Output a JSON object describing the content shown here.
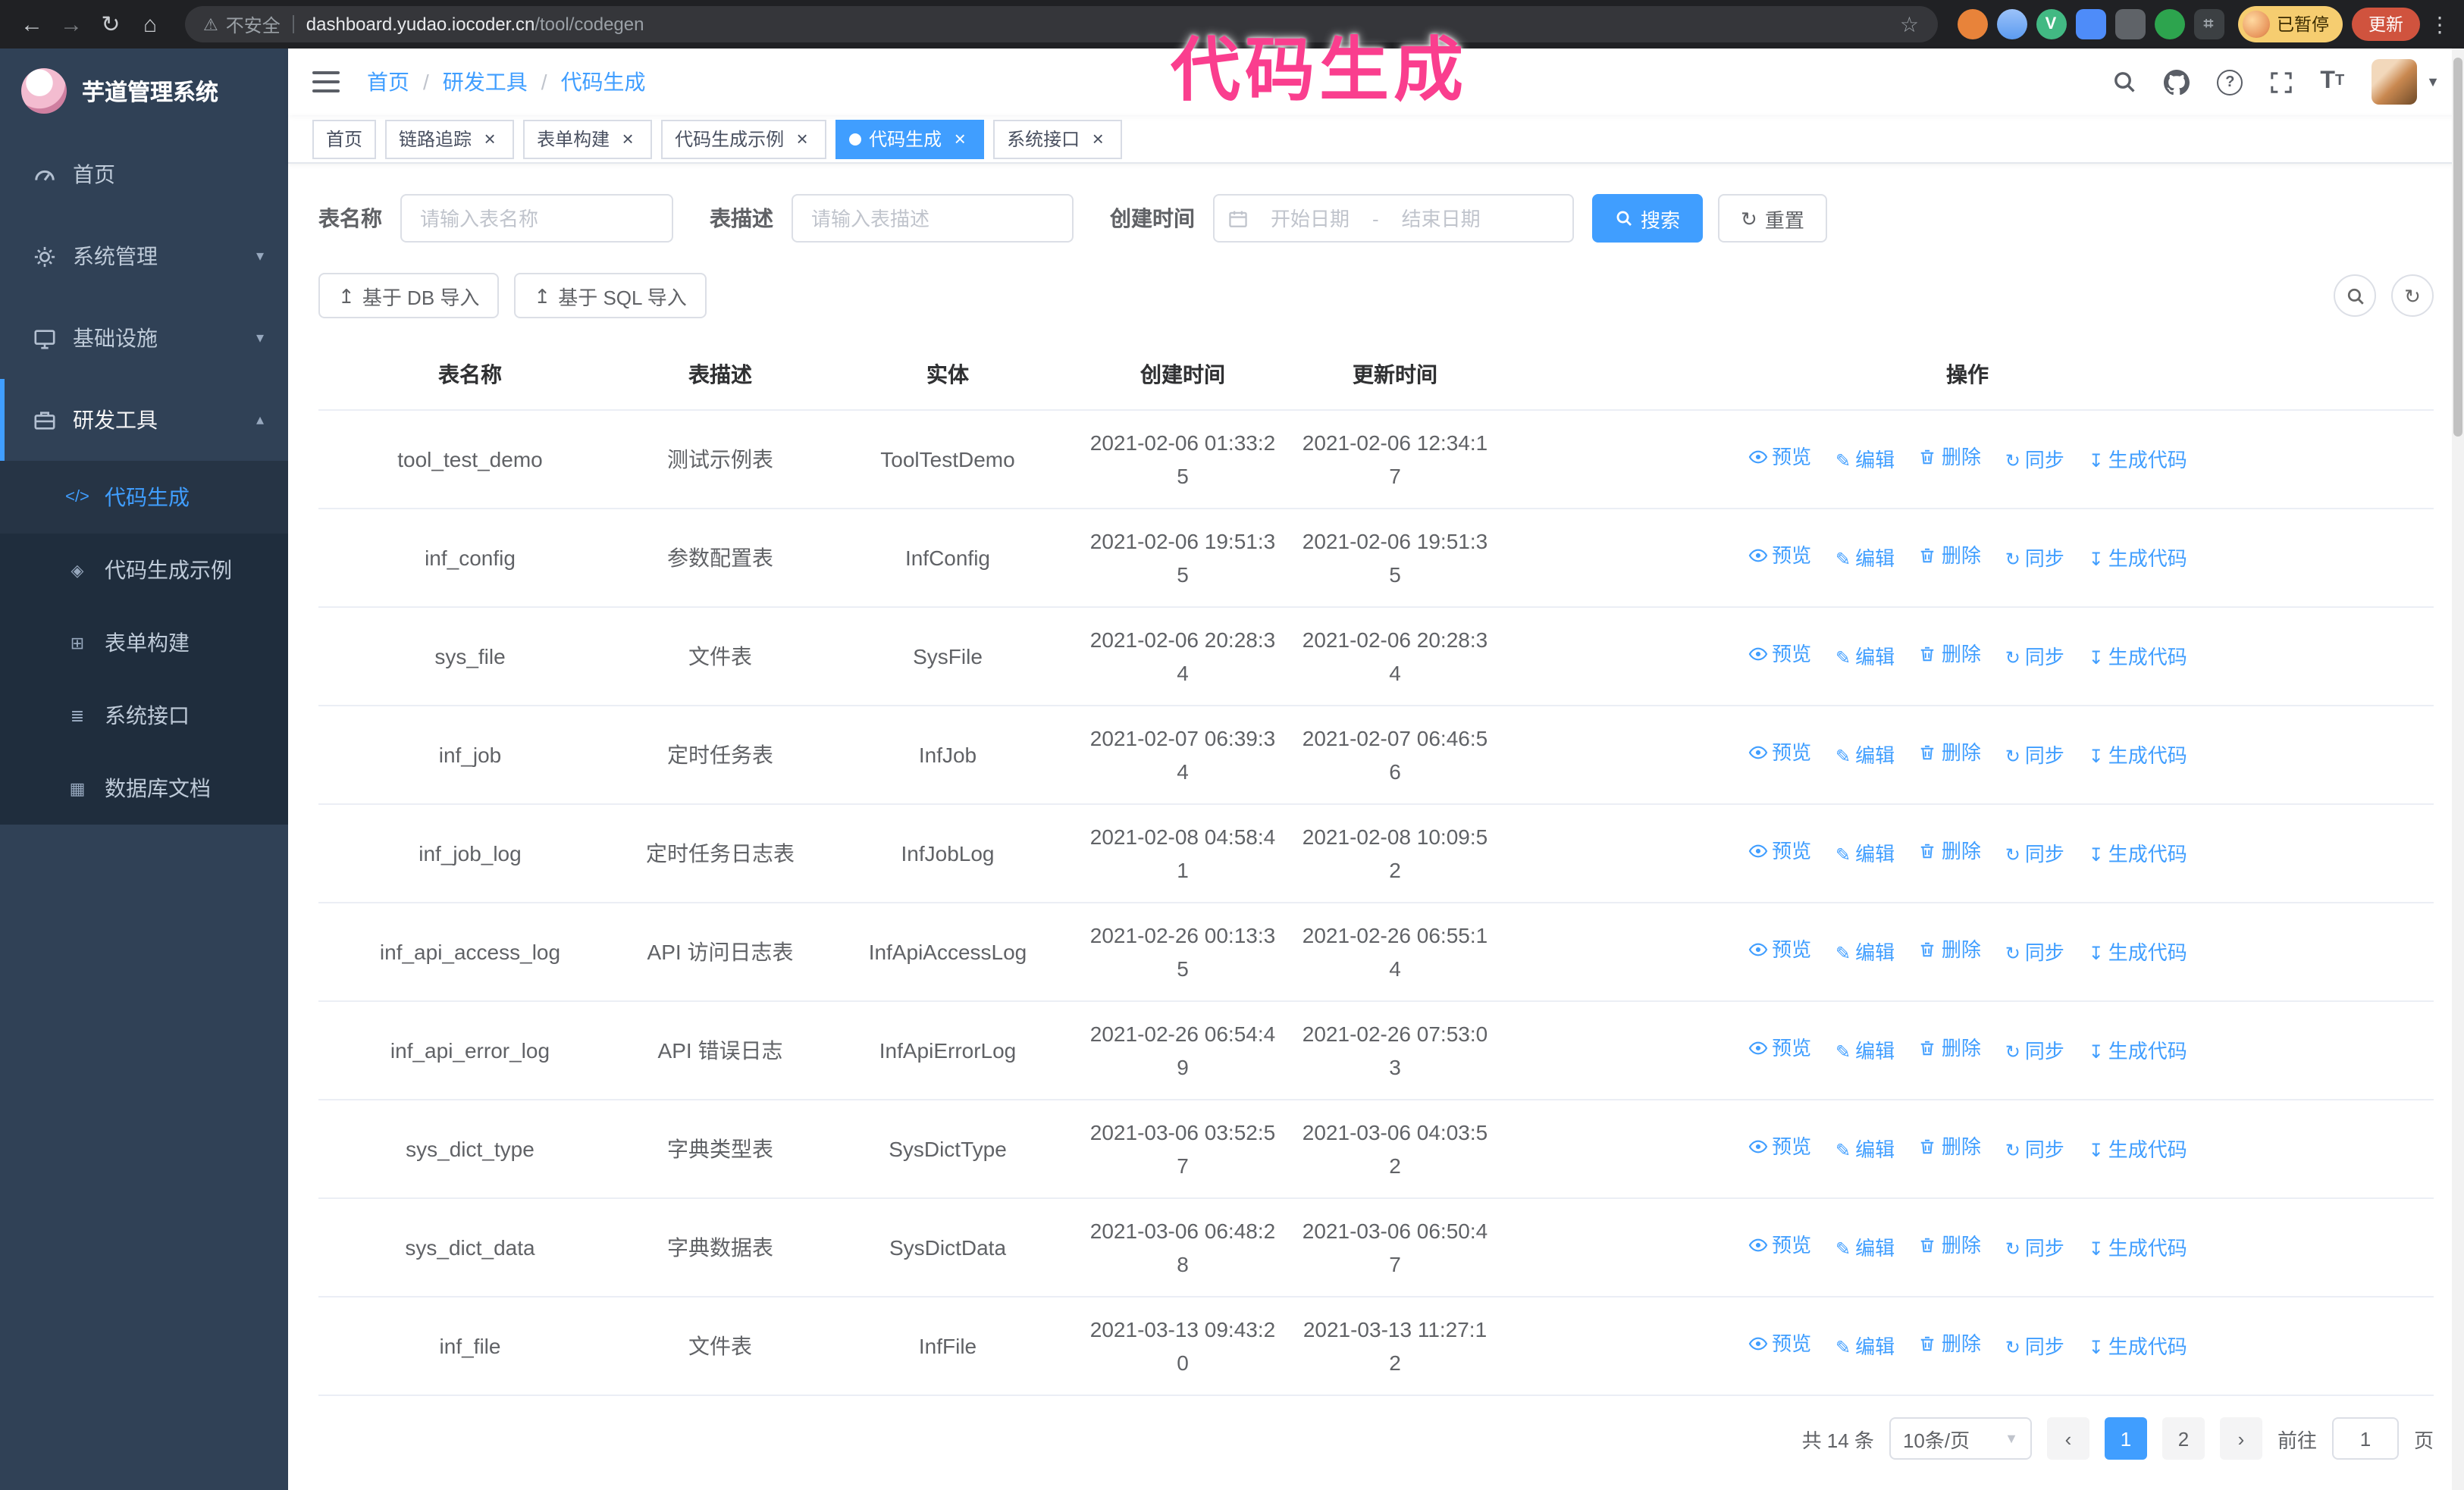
{
  "annotation": {
    "text": "代码生成"
  },
  "browser": {
    "security_label": "不安全",
    "url_domain": "dashboard.yudao.iocoder.cn",
    "url_path": "/tool/codegen",
    "profile_label": "已暂停",
    "update_label": "更新"
  },
  "icons": {
    "back": "←",
    "forward": "→",
    "reload": "↻",
    "home": "⌂",
    "warning": "⚠",
    "star": "☆",
    "kebab": "⋮",
    "chevron_down": "▾",
    "chevron_up": "▴",
    "caret_down": "▼",
    "ext_v": "V",
    "ext_puzzle": "⌗",
    "question": "?",
    "fontsize_large": "T",
    "fontsize_small": "T",
    "refresh": "↻",
    "upload": "↥",
    "edit": "✎",
    "sync": "↻",
    "download": "↧",
    "code": "</>",
    "shield": "◈",
    "form": "⊞",
    "api": "≣",
    "db": "▦",
    "prev": "‹",
    "next": "›",
    "crumb_sep": "/",
    "url_sep": "|",
    "range_sep": "-"
  },
  "sidebar": {
    "app_title": "芋道管理系统",
    "menu": [
      {
        "label": "首页"
      },
      {
        "label": "系统管理"
      },
      {
        "label": "基础设施"
      },
      {
        "label": "研发工具"
      }
    ],
    "submenu": [
      {
        "label": "代码生成"
      },
      {
        "label": "代码生成示例"
      },
      {
        "label": "表单构建"
      },
      {
        "label": "系统接口"
      },
      {
        "label": "数据库文档"
      }
    ]
  },
  "breadcrumb": [
    "首页",
    "研发工具",
    "代码生成"
  ],
  "tags": [
    {
      "label": "首页"
    },
    {
      "label": "链路追踪"
    },
    {
      "label": "表单构建"
    },
    {
      "label": "代码生成示例"
    },
    {
      "label": "代码生成"
    },
    {
      "label": "系统接口"
    }
  ],
  "filters": {
    "name_label": "表名称",
    "name_placeholder": "请输入表名称",
    "desc_label": "表描述",
    "desc_placeholder": "请输入表描述",
    "time_label": "创建时间",
    "start_placeholder": "开始日期",
    "end_placeholder": "结束日期",
    "search_label": "搜索",
    "reset_label": "重置"
  },
  "toolbar": {
    "import_db_label": "基于 DB 导入",
    "import_sql_label": "基于 SQL 导入"
  },
  "table": {
    "columns": [
      "表名称",
      "表描述",
      "实体",
      "创建时间",
      "更新时间",
      "操作"
    ],
    "action_labels": [
      "预览",
      "编辑",
      "删除",
      "同步",
      "生成代码"
    ],
    "rows": [
      {
        "name": "tool_test_demo",
        "desc": "测试示例表",
        "entity": "ToolTestDemo",
        "created": "2021-02-06 01:33:25",
        "updated": "2021-02-06 12:34:17"
      },
      {
        "name": "inf_config",
        "desc": "参数配置表",
        "entity": "InfConfig",
        "created": "2021-02-06 19:51:35",
        "updated": "2021-02-06 19:51:35"
      },
      {
        "name": "sys_file",
        "desc": "文件表",
        "entity": "SysFile",
        "created": "2021-02-06 20:28:34",
        "updated": "2021-02-06 20:28:34"
      },
      {
        "name": "inf_job",
        "desc": "定时任务表",
        "entity": "InfJob",
        "created": "2021-02-07 06:39:34",
        "updated": "2021-02-07 06:46:56"
      },
      {
        "name": "inf_job_log",
        "desc": "定时任务日志表",
        "entity": "InfJobLog",
        "created": "2021-02-08 04:58:41",
        "updated": "2021-02-08 10:09:52"
      },
      {
        "name": "inf_api_access_log",
        "desc": "API 访问日志表",
        "entity": "InfApiAccessLog",
        "created": "2021-02-26 00:13:35",
        "updated": "2021-02-26 06:55:14"
      },
      {
        "name": "inf_api_error_log",
        "desc": "API 错误日志",
        "entity": "InfApiErrorLog",
        "created": "2021-02-26 06:54:49",
        "updated": "2021-02-26 07:53:03"
      },
      {
        "name": "sys_dict_type",
        "desc": "字典类型表",
        "entity": "SysDictType",
        "created": "2021-03-06 03:52:57",
        "updated": "2021-03-06 04:03:52"
      },
      {
        "name": "sys_dict_data",
        "desc": "字典数据表",
        "entity": "SysDictData",
        "created": "2021-03-06 06:48:28",
        "updated": "2021-03-06 06:50:47"
      },
      {
        "name": "inf_file",
        "desc": "文件表",
        "entity": "InfFile",
        "created": "2021-03-13 09:43:20",
        "updated": "2021-03-13 11:27:12"
      }
    ]
  },
  "pagination": {
    "total_label": "共 14 条",
    "page_size_label": "10条/页",
    "page_1": "1",
    "page_2": "2",
    "goto_label": "前往",
    "goto_value": "1",
    "goto_suffix": "页"
  },
  "colors": {
    "accent": "#409eff",
    "annotation": "#fa3e8e",
    "sidebar_bg": "#304156",
    "submenu_bg": "#1f2d3d",
    "browser_bar": "#202124"
  }
}
